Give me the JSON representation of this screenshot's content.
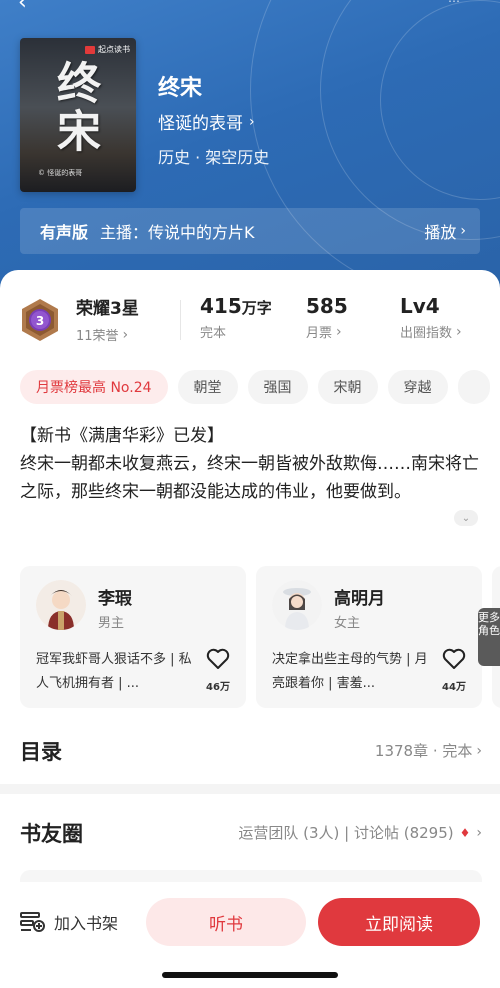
{
  "hero": {
    "cover": {
      "publisher": "起点读书",
      "big_title": "终宋",
      "author_tag": "© 怪诞的表哥"
    },
    "title": "终宋",
    "author": "怪诞的表哥",
    "genre": "历史 · 架空历史",
    "audio": {
      "tag": "有声版",
      "narrator": "主播：传说中的方片K",
      "play_label": "播放"
    }
  },
  "stats": {
    "honor_level": "荣耀3星",
    "badge_number": "3",
    "honor_count": "11荣誉",
    "words_value": "415",
    "words_unit": "万字",
    "words_label": "完本",
    "monthly_votes_value": "585",
    "monthly_votes_label": "月票",
    "circle_level_value": "Lv4",
    "circle_level_label": "出圈指数"
  },
  "tags": [
    "月票榜最高 No.24",
    "朝堂",
    "强国",
    "宋朝",
    "穿越"
  ],
  "intro": {
    "line1": "【新书《满唐华彩》已发】",
    "body": "终宋一朝都未收复燕云，终宋一朝皆被外敌欺侮……南宋将亡之际，那些终宋一朝都没能达成的伟业，他要做到。"
  },
  "characters": [
    {
      "name": "李瑕",
      "role": "男主",
      "desc": "冠军我虾哥人狠话不多 | 私人飞机拥有者 | ...",
      "likes": "46万"
    },
    {
      "name": "高明月",
      "role": "女主",
      "desc": "决定拿出些主母的气势 | 月亮跟着你 | 害羞...",
      "likes": "44万"
    }
  ],
  "more_roles": "更多角色",
  "catalog": {
    "heading": "目录",
    "info": "1378章 · 完本"
  },
  "circle": {
    "heading": "书友圈",
    "info": "运营团队 (3人) | 讨论帖 (8295)"
  },
  "bottom": {
    "shelf_label": "加入书架",
    "listen_label": "听书",
    "read_label": "立即阅读"
  },
  "colors": {
    "accent": "#e0393e",
    "hero_blue": "#2d6bb5"
  }
}
